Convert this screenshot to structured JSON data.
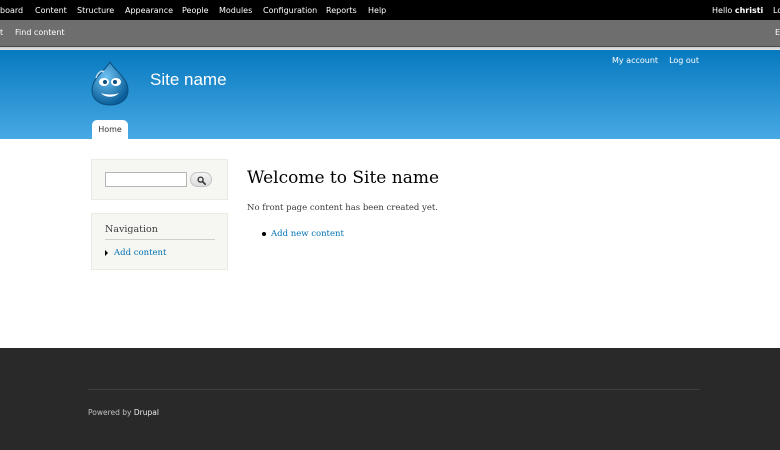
{
  "toolbar": {
    "menu": [
      "board",
      "Content",
      "Structure",
      "Appearance",
      "People",
      "Modules",
      "Configuration",
      "Reports",
      "Help"
    ],
    "hello_label": "Hello",
    "username": "christi",
    "logout_partial": "Lo"
  },
  "shortcuts": {
    "items": [
      "t",
      "Find content"
    ],
    "edit_partial": "E"
  },
  "header": {
    "logo_icon": "drupal-drop-logo-icon",
    "site_name": "Site name",
    "secondary_menu": [
      "My account",
      "Log out"
    ],
    "tabs": [
      "Home"
    ]
  },
  "sidebar": {
    "search": {
      "placeholder": "",
      "button_icon": "search-icon"
    },
    "navigation": {
      "title": "Navigation",
      "items": [
        "Add content"
      ]
    }
  },
  "main": {
    "title": "Welcome to Site name",
    "message": "No front page content has been created yet.",
    "links": [
      "Add new content"
    ]
  },
  "footer": {
    "powered_by": "Powered by",
    "drupal_link": "Drupal"
  },
  "colors": {
    "toolbar_bg": "#000000",
    "shortcut_bg": "#6e6e6e",
    "header_top": "#0779bf",
    "header_bottom": "#48a9e4",
    "link": "#0071b3",
    "footer_bg": "#292929"
  }
}
